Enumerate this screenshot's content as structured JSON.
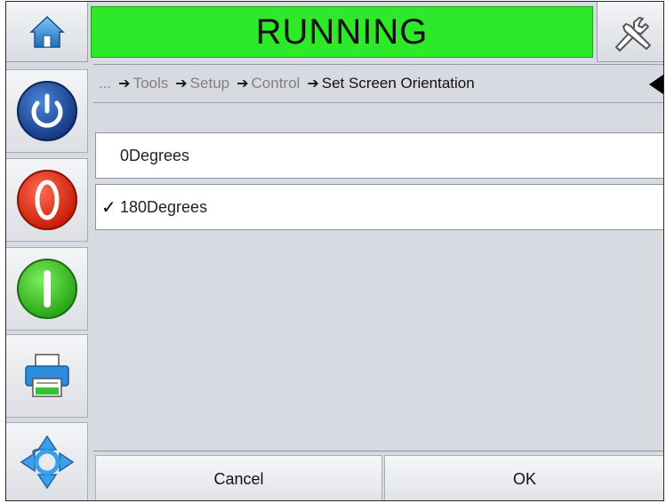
{
  "header": {
    "status": "RUNNING",
    "status_color": "#2ee82a",
    "home_icon": "home-icon",
    "tools_icon": "tools-icon"
  },
  "sidebar": {
    "buttons": [
      {
        "name": "power",
        "icon": "power-icon"
      },
      {
        "name": "stop",
        "icon": "stop-icon"
      },
      {
        "name": "start",
        "icon": "start-icon"
      },
      {
        "name": "print",
        "icon": "printer-icon"
      },
      {
        "name": "navigate",
        "icon": "navigation-arrows-icon"
      }
    ]
  },
  "breadcrumb": {
    "ellipsis": "...",
    "items": [
      "Tools",
      "Setup",
      "Control",
      "Set Screen Orientation"
    ]
  },
  "options": [
    {
      "label": "0Degrees",
      "selected": false
    },
    {
      "label": "180Degrees",
      "selected": true
    }
  ],
  "footer": {
    "cancel_label": "Cancel",
    "ok_label": "OK"
  }
}
